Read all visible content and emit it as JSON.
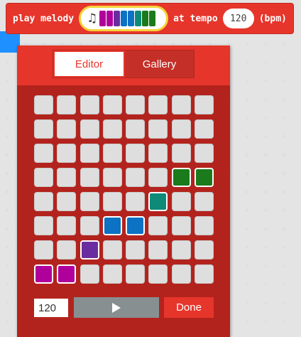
{
  "block": {
    "prefix": "play melody",
    "middle": "at tempo",
    "tempo_value": "120",
    "suffix": "(bpm)",
    "note_icon": "music-note-icon",
    "preview_colors": [
      "#b0009b",
      "#b0009b",
      "#6a2da0",
      "#0b72c4",
      "#0b72c4",
      "#0d8a78",
      "#1b7a1b",
      "#1b7a1b"
    ]
  },
  "tabs": [
    {
      "label": "Editor",
      "selected": true
    },
    {
      "label": "Gallery",
      "selected": false
    }
  ],
  "grid": {
    "rows": 8,
    "cols": 8,
    "empty_color": "#dedede",
    "filled": [
      {
        "row": 3,
        "col": 6,
        "color": "#1b7a1b"
      },
      {
        "row": 3,
        "col": 7,
        "color": "#1b7a1b"
      },
      {
        "row": 4,
        "col": 5,
        "color": "#0d8a78"
      },
      {
        "row": 5,
        "col": 3,
        "color": "#0b72c4"
      },
      {
        "row": 5,
        "col": 4,
        "color": "#0b72c4"
      },
      {
        "row": 6,
        "col": 2,
        "color": "#6a2da0"
      },
      {
        "row": 7,
        "col": 0,
        "color": "#b0009b"
      },
      {
        "row": 7,
        "col": 1,
        "color": "#b0009b"
      }
    ]
  },
  "controls": {
    "tempo_input": "120",
    "play_icon": "play-icon",
    "done_label": "Done"
  },
  "colors": {
    "accent": "#e6352b",
    "editor_bg": "#b3231d",
    "field_border": "#f5d33b"
  }
}
